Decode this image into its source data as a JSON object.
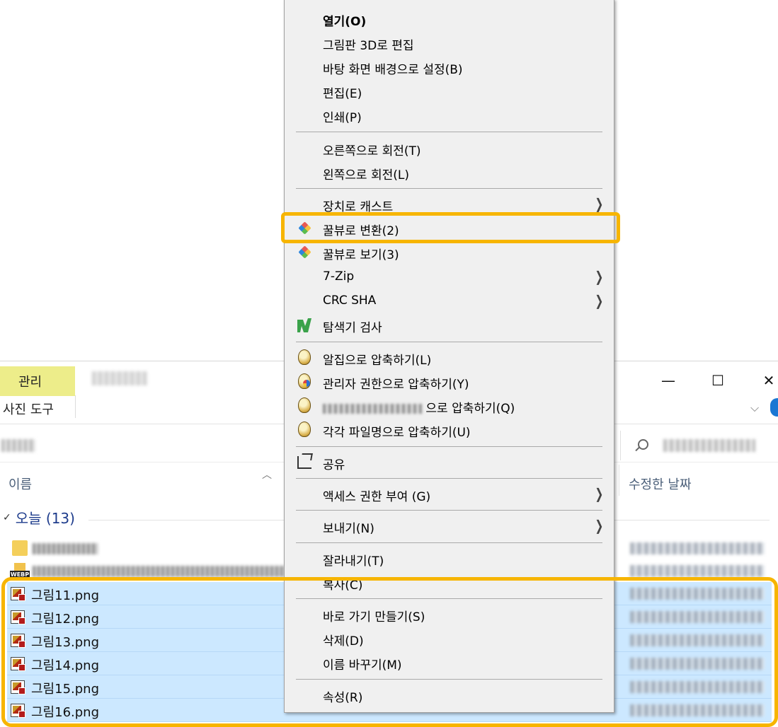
{
  "explorer": {
    "ribbon": {
      "tab_manage": "관리",
      "tab_photo_tools": "사진 도구"
    },
    "window_controls": {
      "minimize": "—",
      "maximize": "☐",
      "close": "✕"
    },
    "columns": {
      "name": "이름",
      "date_modified": "수정한 날짜"
    },
    "group": {
      "label": "오늘 (13)"
    },
    "webp_tag": "WEBP",
    "files": [
      {
        "name": "그림11.png",
        "selected": true
      },
      {
        "name": "그림12.png",
        "selected": true
      },
      {
        "name": "그림13.png",
        "selected": true
      },
      {
        "name": "그림14.png",
        "selected": true
      },
      {
        "name": "그림15.png",
        "selected": true
      },
      {
        "name": "그림16.png",
        "selected": true
      }
    ]
  },
  "context_menu": {
    "items": [
      {
        "label": "열기(O)",
        "bold": true
      },
      {
        "label": "그림판 3D로 편집"
      },
      {
        "label": "바탕 화면 배경으로 설정(B)"
      },
      {
        "label": "편집(E)"
      },
      {
        "label": "인쇄(P)"
      },
      {
        "label": "오른쪽으로 회전(T)"
      },
      {
        "label": "왼쪽으로 회전(L)"
      },
      {
        "label": "장치로 캐스트",
        "submenu": true
      },
      {
        "label": "꿀뷰로 변환(2)",
        "icon": "honeyview-icon"
      },
      {
        "label": "꿀뷰로 보기(3)",
        "icon": "honeyview-icon"
      },
      {
        "label": "7-Zip",
        "submenu": true
      },
      {
        "label": "CRC SHA",
        "submenu": true
      },
      {
        "label": "탐색기 검사",
        "icon": "scan-icon"
      },
      {
        "label": "알집으로 압축하기(L)",
        "icon": "alzip-icon"
      },
      {
        "label": "관리자 권한으로 압축하기(Y)",
        "icon": "alzip-admin-icon"
      },
      {
        "label": "으로 압축하기(Q)",
        "icon": "alzip-icon"
      },
      {
        "label": "각각 파일명으로 압축하기(U)",
        "icon": "alzip-icon"
      },
      {
        "label": "공유",
        "icon": "share-icon"
      },
      {
        "label": "액세스 권한 부여 (G)",
        "submenu": true
      },
      {
        "label": "보내기(N)",
        "submenu": true
      },
      {
        "label": "잘라내기(T)"
      },
      {
        "label": "복사(C)"
      },
      {
        "label": "바로 가기 만들기(S)"
      },
      {
        "label": "삭제(D)"
      },
      {
        "label": "이름 바꾸기(M)"
      },
      {
        "label": "속성(R)"
      }
    ],
    "submenu_arrow": "❯"
  },
  "highlights": {
    "color": "#f7b500"
  },
  "colors": {
    "selection": "#cce8ff",
    "ribbon_manage": "#eded8a",
    "menu_bg": "#f0f0f0"
  }
}
